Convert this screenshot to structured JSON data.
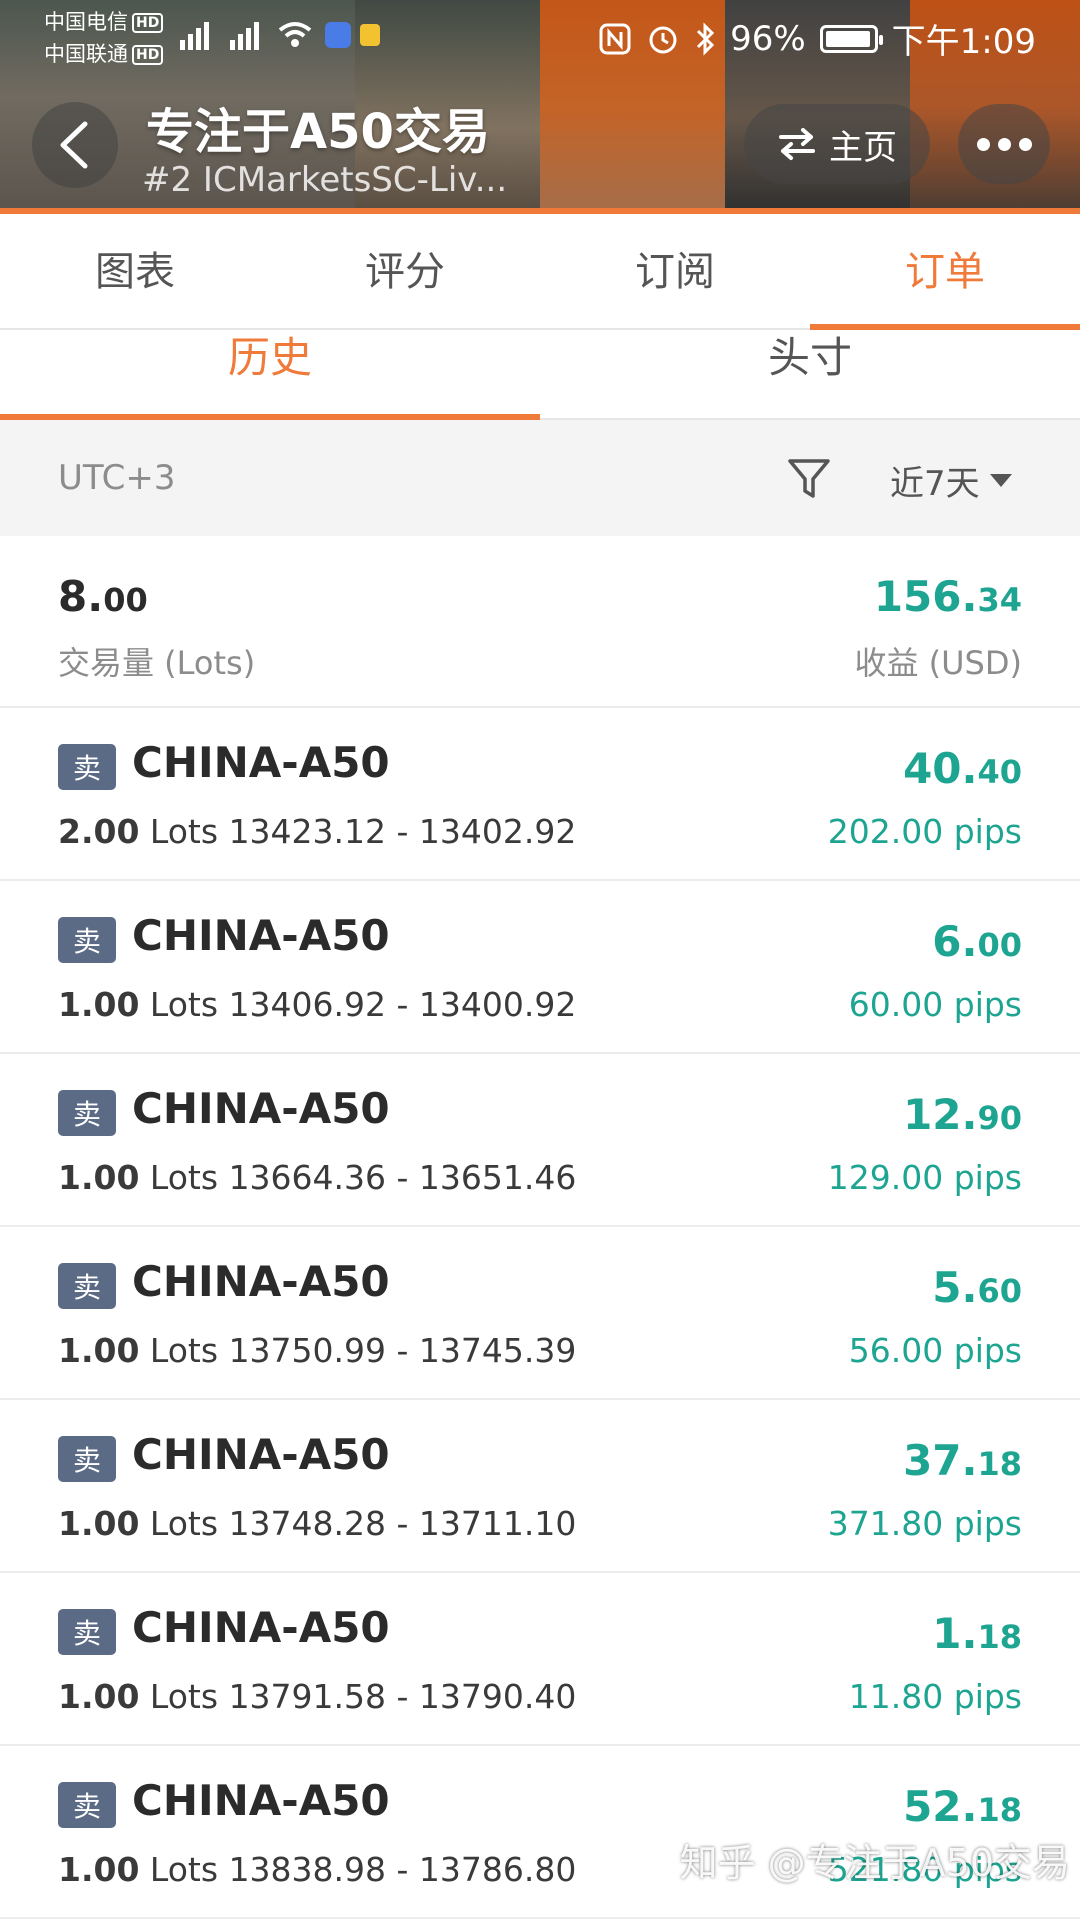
{
  "status_bar": {
    "carrier_1": "中国电信",
    "carrier_2": "中国联通",
    "hd": "HD",
    "battery": "96%",
    "battery_level": 0.96,
    "time": "下午1:09"
  },
  "header": {
    "title": "专注于A50交易",
    "subtitle": "#2  ICMarketsSC-Liv...",
    "home_label": "主页"
  },
  "main_tabs": [
    {
      "label": "图表",
      "active": false
    },
    {
      "label": "评分",
      "active": false
    },
    {
      "label": "订阅",
      "active": false
    },
    {
      "label": "订单",
      "active": true
    }
  ],
  "sub_tabs": [
    {
      "label": "历史",
      "active": true
    },
    {
      "label": "头寸",
      "active": false
    }
  ],
  "filter": {
    "timezone": "UTC+3",
    "range": "近7天"
  },
  "summary": {
    "volume_int": "8.",
    "volume_dec": "00",
    "volume_label": "交易量 (Lots)",
    "profit_int": "156.",
    "profit_dec": "34",
    "profit_label": "收益 (USD)"
  },
  "orders": [
    {
      "side": "卖",
      "symbol": "CHINA-A50",
      "lots": "2.00",
      "lots_unit": "Lots",
      "prices": "13423.12 - 13402.92",
      "profit_int": "40.",
      "profit_dec": "40",
      "pips": "202.00 pips"
    },
    {
      "side": "卖",
      "symbol": "CHINA-A50",
      "lots": "1.00",
      "lots_unit": "Lots",
      "prices": "13406.92 - 13400.92",
      "profit_int": "6.",
      "profit_dec": "00",
      "pips": "60.00 pips"
    },
    {
      "side": "卖",
      "symbol": "CHINA-A50",
      "lots": "1.00",
      "lots_unit": "Lots",
      "prices": "13664.36 - 13651.46",
      "profit_int": "12.",
      "profit_dec": "90",
      "pips": "129.00 pips"
    },
    {
      "side": "卖",
      "symbol": "CHINA-A50",
      "lots": "1.00",
      "lots_unit": "Lots",
      "prices": "13750.99 - 13745.39",
      "profit_int": "5.",
      "profit_dec": "60",
      "pips": "56.00 pips"
    },
    {
      "side": "卖",
      "symbol": "CHINA-A50",
      "lots": "1.00",
      "lots_unit": "Lots",
      "prices": "13748.28 - 13711.10",
      "profit_int": "37.",
      "profit_dec": "18",
      "pips": "371.80 pips"
    },
    {
      "side": "卖",
      "symbol": "CHINA-A50",
      "lots": "1.00",
      "lots_unit": "Lots",
      "prices": "13791.58 - 13790.40",
      "profit_int": "1.",
      "profit_dec": "18",
      "pips": "11.80 pips"
    },
    {
      "side": "卖",
      "symbol": "CHINA-A50",
      "lots": "1.00",
      "lots_unit": "Lots",
      "prices": "13838.98 - 13786.80",
      "profit_int": "52.",
      "profit_dec": "18",
      "pips": "521.80 pips"
    }
  ],
  "watermark": "知乎 @专注于A50交易",
  "colors": {
    "accent": "#f07a3a",
    "profit": "#1ea592",
    "badge": "#5b6b85"
  }
}
